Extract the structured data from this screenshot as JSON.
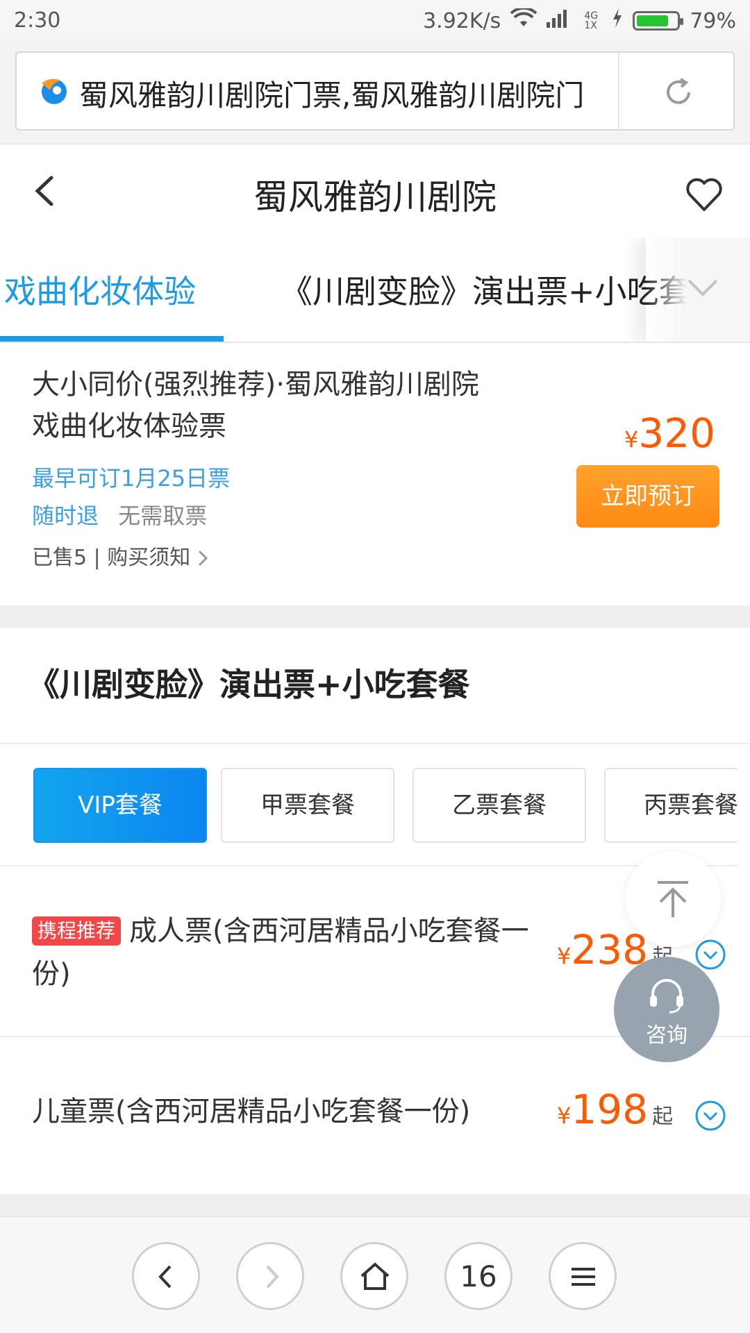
{
  "status_bar": {
    "time": "2:30",
    "network_speed": "3.92K/s",
    "network_type": "4G 1X",
    "battery": "79%",
    "battery_level": 0.79
  },
  "browser": {
    "url_text": "蜀风雅韵川剧院门票,蜀风雅韵川剧院门",
    "tab_count": "16"
  },
  "header": {
    "title": "蜀风雅韵川剧院"
  },
  "tabs": [
    {
      "label": "戏曲化妆体验",
      "active": true
    },
    {
      "label": "《川剧变脸》演出票+小吃套",
      "active": false
    }
  ],
  "ticket_main": {
    "title_line1": "大小同价(强烈推荐)·蜀风雅韵川剧院",
    "title_line2": "戏曲化妆体验票",
    "earliest": "最早可订1月25日票",
    "tag_refund": "随时退",
    "tag_no_pickup": "无需取票",
    "sold_info": "已售5 | 购买须知 ",
    "currency": "¥",
    "price": "320",
    "book_label": "立即预订"
  },
  "section2": {
    "title": "《川剧变脸》演出票+小吃套餐",
    "packages": [
      "VIP套餐",
      "甲票套餐",
      "乙票套餐",
      "丙票套餐"
    ],
    "tickets": [
      {
        "badge": "携程推荐",
        "title": "成人票(含西河居精品小吃套餐一份)",
        "currency": "¥",
        "price": "238",
        "suffix": "起"
      },
      {
        "badge": "",
        "title": "儿童票(含西河居精品小吃套餐一份)",
        "currency": "¥",
        "price": "198",
        "suffix": "起"
      }
    ]
  },
  "floating": {
    "consult_label": "咨询"
  },
  "colors": {
    "accent_blue": "#1a9be5",
    "price_orange": "#ff5a00",
    "book_button": "#ff9a1f",
    "badge_red": "#f04848"
  }
}
